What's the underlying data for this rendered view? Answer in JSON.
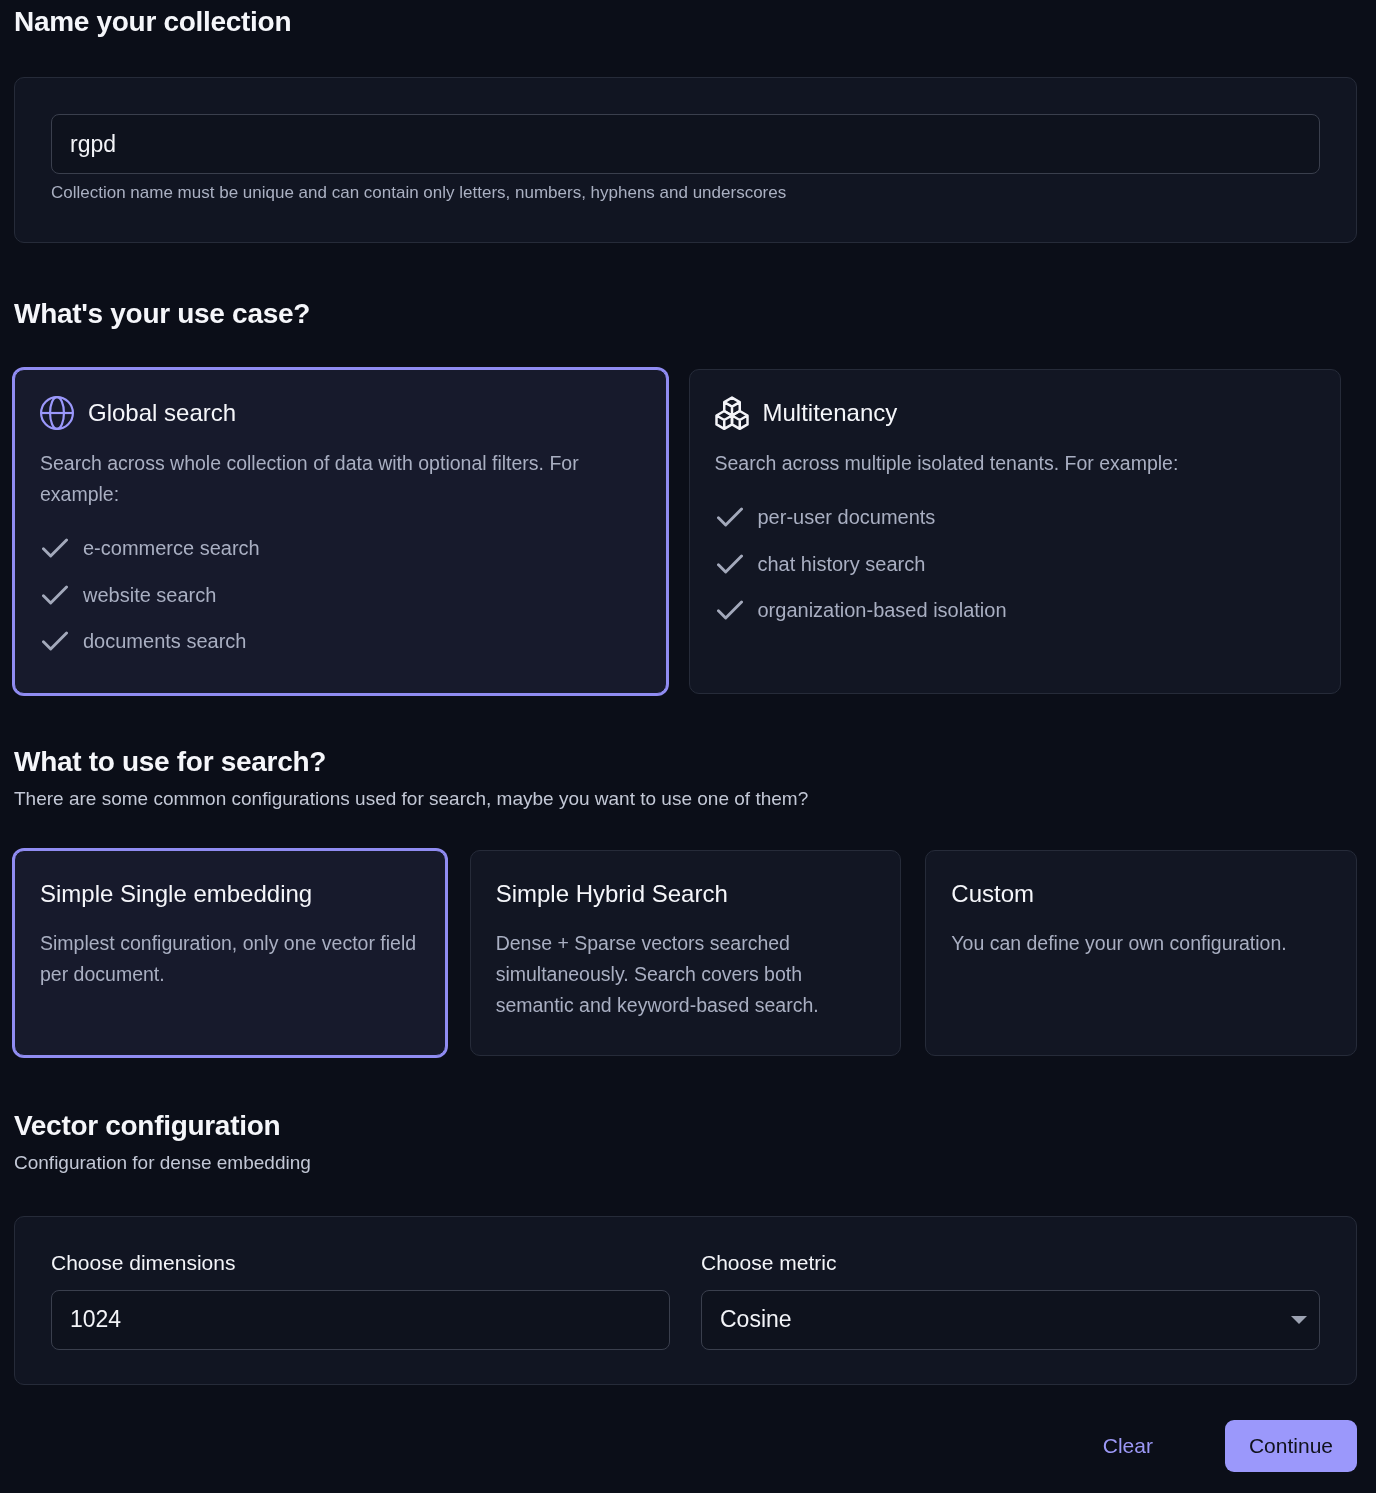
{
  "name_section": {
    "title": "Name your collection",
    "field": {
      "value": "rgpd"
    },
    "help": "Collection name must be unique and can contain only letters, numbers, hyphens and underscores"
  },
  "use_case_section": {
    "title": "What's your use case?",
    "options": [
      {
        "kind": "global",
        "title": "Global search",
        "description": "Search across whole collection of data with optional filters. For example:",
        "examples": [
          "e-commerce search",
          "website search",
          "documents search"
        ],
        "selected": true
      },
      {
        "kind": "tenants",
        "title": "Multitenancy",
        "description": "Search across multiple isolated tenants. For example:",
        "examples": [
          "per-user documents",
          "chat history search",
          "organization-based isolation"
        ],
        "selected": false
      }
    ]
  },
  "search_section": {
    "title": "What to use for search?",
    "subtitle": "There are some common configurations used for search, maybe you want to use one of them?",
    "options": [
      {
        "title": "Simple Single embedding",
        "description": "Simplest configuration, only one vector field per document.",
        "selected": true
      },
      {
        "title": "Simple Hybrid Search",
        "description": "Dense + Sparse vectors searched simultaneously. Search covers both semantic and keyword-based search.",
        "selected": false
      },
      {
        "title": "Custom",
        "description": "You can define your own configuration.",
        "selected": false
      }
    ]
  },
  "vector_section": {
    "title": "Vector configuration",
    "subtitle": "Configuration for dense embedding",
    "dimensions": {
      "label": "Choose dimensions",
      "value": "1024"
    },
    "metric": {
      "label": "Choose metric",
      "value": "Cosine"
    }
  },
  "actions": [
    {
      "kind": "text",
      "label": "Clear"
    },
    {
      "kind": "primary",
      "label": "Continue"
    }
  ]
}
